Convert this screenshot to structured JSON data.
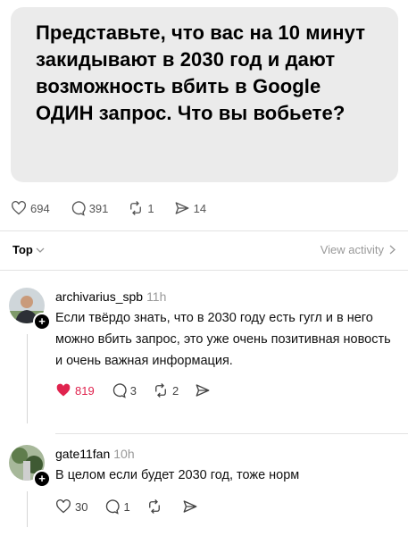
{
  "post": {
    "text": "Представьте, что вас на 10 минут закидывают в 2030 год и дают возможность вбить в Google ОДИН запрос. Что вы вобьете?",
    "stats": {
      "likes": "694",
      "comments": "391",
      "reposts": "1",
      "shares": "14"
    }
  },
  "sort_bar": {
    "sort_label": "Top",
    "view_activity_label": "View activity"
  },
  "comments": [
    {
      "username": "archivarius_spb",
      "time": "11h",
      "text": "Если твёрдо знать, что в 2030 году есть гугл и в него можно вбить запрос, это уже очень позитивная новость и очень важная информация.",
      "likes": "819",
      "replies": "3",
      "reposts": "2",
      "liked": true
    },
    {
      "username": "gate11fan",
      "time": "10h",
      "text": "В целом если будет 2030 год, тоже норм",
      "likes": "30",
      "replies": "1",
      "reposts": "",
      "liked": false
    }
  ],
  "colors": {
    "like_active": "#e0234e",
    "post_bg": "#ebebeb",
    "muted": "#999999"
  }
}
